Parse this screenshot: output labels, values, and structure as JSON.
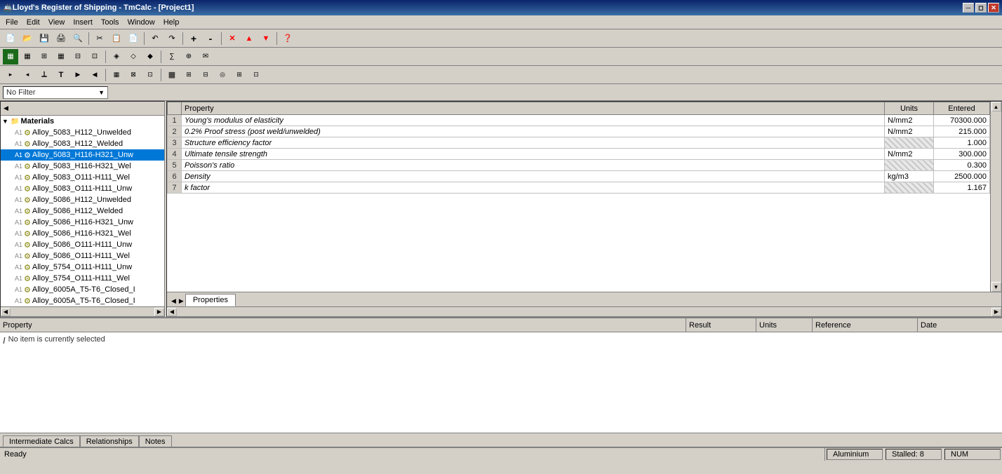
{
  "titlebar": {
    "icon": "🚢",
    "title": "Lloyd's Register of Shipping - TmCalc - [Project1]",
    "minimize": "─",
    "restore": "◻",
    "close": "✕"
  },
  "menubar": {
    "items": [
      "File",
      "Edit",
      "View",
      "Insert",
      "Tools",
      "Window",
      "Help"
    ]
  },
  "toolbar1": {
    "buttons": [
      "📄",
      "📂",
      "💾",
      "🖨",
      "🔍",
      "✂",
      "📋",
      "📄",
      "↶",
      "↷",
      "🔍",
      "🔍",
      "✕",
      "⬆",
      "⬇",
      "❓"
    ]
  },
  "toolbar2": {
    "buttons": [
      "▦",
      "▦",
      "▦",
      "▦",
      "▦",
      "▦",
      "▦",
      "▦",
      "▦",
      "▦",
      "▦",
      "▦",
      "▦",
      "▦",
      "▦",
      "▦",
      "▦",
      "▦",
      "▦"
    ]
  },
  "toolbar3": {
    "buttons": [
      "▸",
      "◂",
      "⟂",
      "T",
      "▸",
      "◂",
      "▦",
      "▦",
      "▦",
      "▦",
      "▦",
      "▦",
      "▦",
      "▦",
      "▦",
      "▦",
      "▦",
      "▦",
      "▦"
    ]
  },
  "filter": {
    "label": "No Filter",
    "dropdown_arrow": "▼"
  },
  "tree": {
    "title": "Materials",
    "nodes": [
      {
        "id": 1,
        "label": "Materials",
        "level": 0,
        "expanded": true,
        "type": "folder"
      },
      {
        "id": 2,
        "label": "Alloy_5083_H112_Unwelded",
        "level": 1,
        "type": "material",
        "prefix": "A1"
      },
      {
        "id": 3,
        "label": "Alloy_5083_H112_Welded",
        "level": 1,
        "type": "material",
        "prefix": "A1"
      },
      {
        "id": 4,
        "label": "Alloy_5083_H116-H321_Unw",
        "level": 1,
        "type": "material",
        "prefix": "A1",
        "selected": true
      },
      {
        "id": 5,
        "label": "Alloy_5083_H116-H321_Wel",
        "level": 1,
        "type": "material",
        "prefix": "A1"
      },
      {
        "id": 6,
        "label": "Alloy_5083_O111-H111_Wel",
        "level": 1,
        "type": "material",
        "prefix": "A1"
      },
      {
        "id": 7,
        "label": "Alloy_5083_O111-H111_Unw",
        "level": 1,
        "type": "material",
        "prefix": "A1"
      },
      {
        "id": 8,
        "label": "Alloy_5086_H112_Unwelded",
        "level": 1,
        "type": "material",
        "prefix": "A1"
      },
      {
        "id": 9,
        "label": "Alloy_5086_H112_Welded",
        "level": 1,
        "type": "material",
        "prefix": "A1"
      },
      {
        "id": 10,
        "label": "Alloy_5086_H116-H321_Unw",
        "level": 1,
        "type": "material",
        "prefix": "A1"
      },
      {
        "id": 11,
        "label": "Alloy_5086_H116-H321_Wel",
        "level": 1,
        "type": "material",
        "prefix": "A1"
      },
      {
        "id": 12,
        "label": "Alloy_5086_O111-H111_Unw",
        "level": 1,
        "type": "material",
        "prefix": "A1"
      },
      {
        "id": 13,
        "label": "Alloy_5086_O111-H111_Wel",
        "level": 1,
        "type": "material",
        "prefix": "A1"
      },
      {
        "id": 14,
        "label": "Alloy_5754_O111-H111_Unw",
        "level": 1,
        "type": "material",
        "prefix": "A1"
      },
      {
        "id": 15,
        "label": "Alloy_5754_O111-H111_Wel",
        "level": 1,
        "type": "material",
        "prefix": "A1"
      },
      {
        "id": 16,
        "label": "Alloy_6005A_T5-T6_Closed_I",
        "level": 1,
        "type": "material",
        "prefix": "A1"
      },
      {
        "id": 17,
        "label": "Alloy_6005A_T5-T6_Closed_I",
        "level": 1,
        "type": "material",
        "prefix": "A1"
      }
    ]
  },
  "properties_table": {
    "headers": [
      "",
      "Property",
      "Units",
      "Entered"
    ],
    "rows": [
      {
        "num": "1",
        "name": "Young's modulus of elasticity",
        "units": "N/mm2",
        "value": "70300.000",
        "hatched": false
      },
      {
        "num": "2",
        "name": "0.2% Proof stress (post weld/unwelded)",
        "units": "N/mm2",
        "value": "215.000",
        "hatched": false
      },
      {
        "num": "3",
        "name": "Structure efficiency factor",
        "units": "",
        "value": "1.000",
        "hatched": true
      },
      {
        "num": "4",
        "name": "Ultimate tensile strength",
        "units": "N/mm2",
        "value": "300.000",
        "hatched": false
      },
      {
        "num": "5",
        "name": "Poisson's ratio",
        "units": "",
        "value": "0.300",
        "hatched": true
      },
      {
        "num": "6",
        "name": "Density",
        "units": "kg/m3",
        "value": "2500.000",
        "hatched": false
      },
      {
        "num": "7",
        "name": "k factor",
        "units": "",
        "value": "1.167",
        "hatched": true
      }
    ]
  },
  "props_tabs": {
    "active": "Properties",
    "items": [
      "Properties"
    ]
  },
  "bottom_panel": {
    "columns": {
      "property": "Property",
      "result": "Result",
      "units": "Units",
      "reference": "Reference",
      "date": "Date"
    },
    "status_text": "No item is currently selected"
  },
  "bottom_tabs": {
    "items": [
      "Intermediate Calcs",
      "Relationships",
      "Notes"
    ]
  },
  "statusbar": {
    "ready": "Ready",
    "material": "Aluminium",
    "stalled": "Stalled: 8",
    "num": "NUM"
  }
}
